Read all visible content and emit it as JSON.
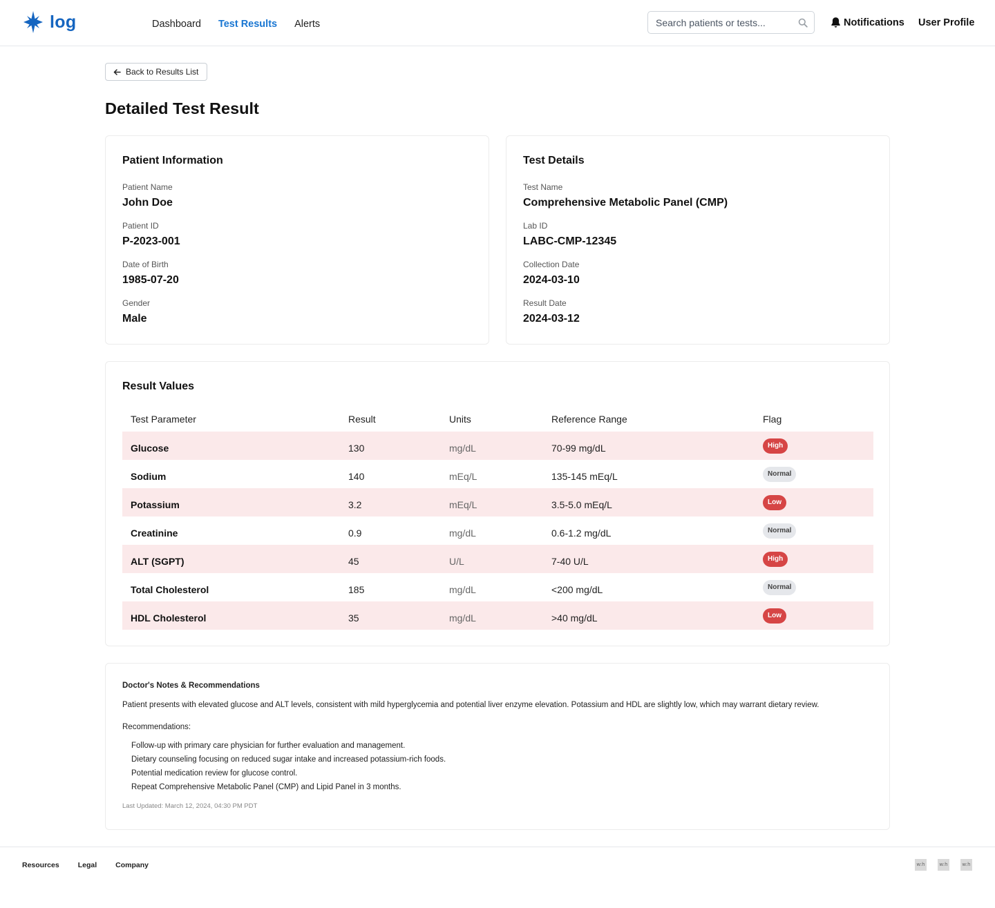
{
  "header": {
    "brand": "log",
    "nav": [
      {
        "label": "Dashboard",
        "active": false
      },
      {
        "label": "Test Results",
        "active": true
      },
      {
        "label": "Alerts",
        "active": false
      }
    ],
    "search_placeholder": "Search patients or tests...",
    "notifications_label": "Notifications",
    "profile_label": "User Profile",
    "accent_color": "#1976d2"
  },
  "back_label": "Back to Results List",
  "page_title": "Detailed Test Result",
  "patient": {
    "title": "Patient Information",
    "fields": [
      {
        "label": "Patient Name",
        "value": "John Doe"
      },
      {
        "label": "Patient ID",
        "value": "P-2023-001"
      },
      {
        "label": "Date of Birth",
        "value": "1985-07-20"
      },
      {
        "label": "Gender",
        "value": "Male"
      }
    ]
  },
  "test": {
    "title": "Test Details",
    "fields": [
      {
        "label": "Test Name",
        "value": "Comprehensive Metabolic Panel (CMP)"
      },
      {
        "label": "Lab ID",
        "value": "LABC-CMP-12345"
      },
      {
        "label": "Collection Date",
        "value": "2024-03-10"
      },
      {
        "label": "Result Date",
        "value": "2024-03-12"
      }
    ]
  },
  "results": {
    "title": "Result Values",
    "headers": [
      "Test Parameter",
      "Result",
      "Units",
      "Reference Range",
      "Flag"
    ],
    "rows": [
      {
        "param": "Glucose",
        "result": "130",
        "units": "mg/dL",
        "range": "70-99 mg/dL",
        "flag": "High"
      },
      {
        "param": "Sodium",
        "result": "140",
        "units": "mEq/L",
        "range": "135-145 mEq/L",
        "flag": "Normal"
      },
      {
        "param": "Potassium",
        "result": "3.2",
        "units": "mEq/L",
        "range": "3.5-5.0 mEq/L",
        "flag": "Low"
      },
      {
        "param": "Creatinine",
        "result": "0.9",
        "units": "mg/dL",
        "range": "0.6-1.2 mg/dL",
        "flag": "Normal"
      },
      {
        "param": "ALT (SGPT)",
        "result": "45",
        "units": "U/L",
        "range": "7-40 U/L",
        "flag": "High"
      },
      {
        "param": "Total Cholesterol",
        "result": "185",
        "units": "mg/dL",
        "range": "<200 mg/dL",
        "flag": "Normal"
      },
      {
        "param": "HDL Cholesterol",
        "result": "35",
        "units": "mg/dL",
        "range": ">40 mg/dL",
        "flag": "Low"
      }
    ],
    "flag_color": "#d64545",
    "flag_row_color": "#fbe9ea"
  },
  "notes": {
    "title": "Doctor's Notes & Recommendations",
    "text": "Patient presents with elevated glucose and ALT levels, consistent with mild hyperglycemia and potential liver enzyme elevation. Potassium and HDL are slightly low, which may warrant dietary review.",
    "recommendations_label": "Recommendations:",
    "recommendations": [
      "Follow-up with primary care physician for further evaluation and management.",
      "Dietary counseling focusing on reduced sugar intake and increased potassium-rich foods.",
      "Potential medication review for glucose control.",
      "Repeat Comprehensive Metabolic Panel (CMP) and Lipid Panel in 3 months."
    ],
    "last_updated": "Last Updated: March 12, 2024, 04:30 PM PDT"
  },
  "footer": {
    "links": [
      "Resources",
      "Legal",
      "Company"
    ],
    "social": [
      "w:h",
      "w:h",
      "w:h"
    ]
  }
}
